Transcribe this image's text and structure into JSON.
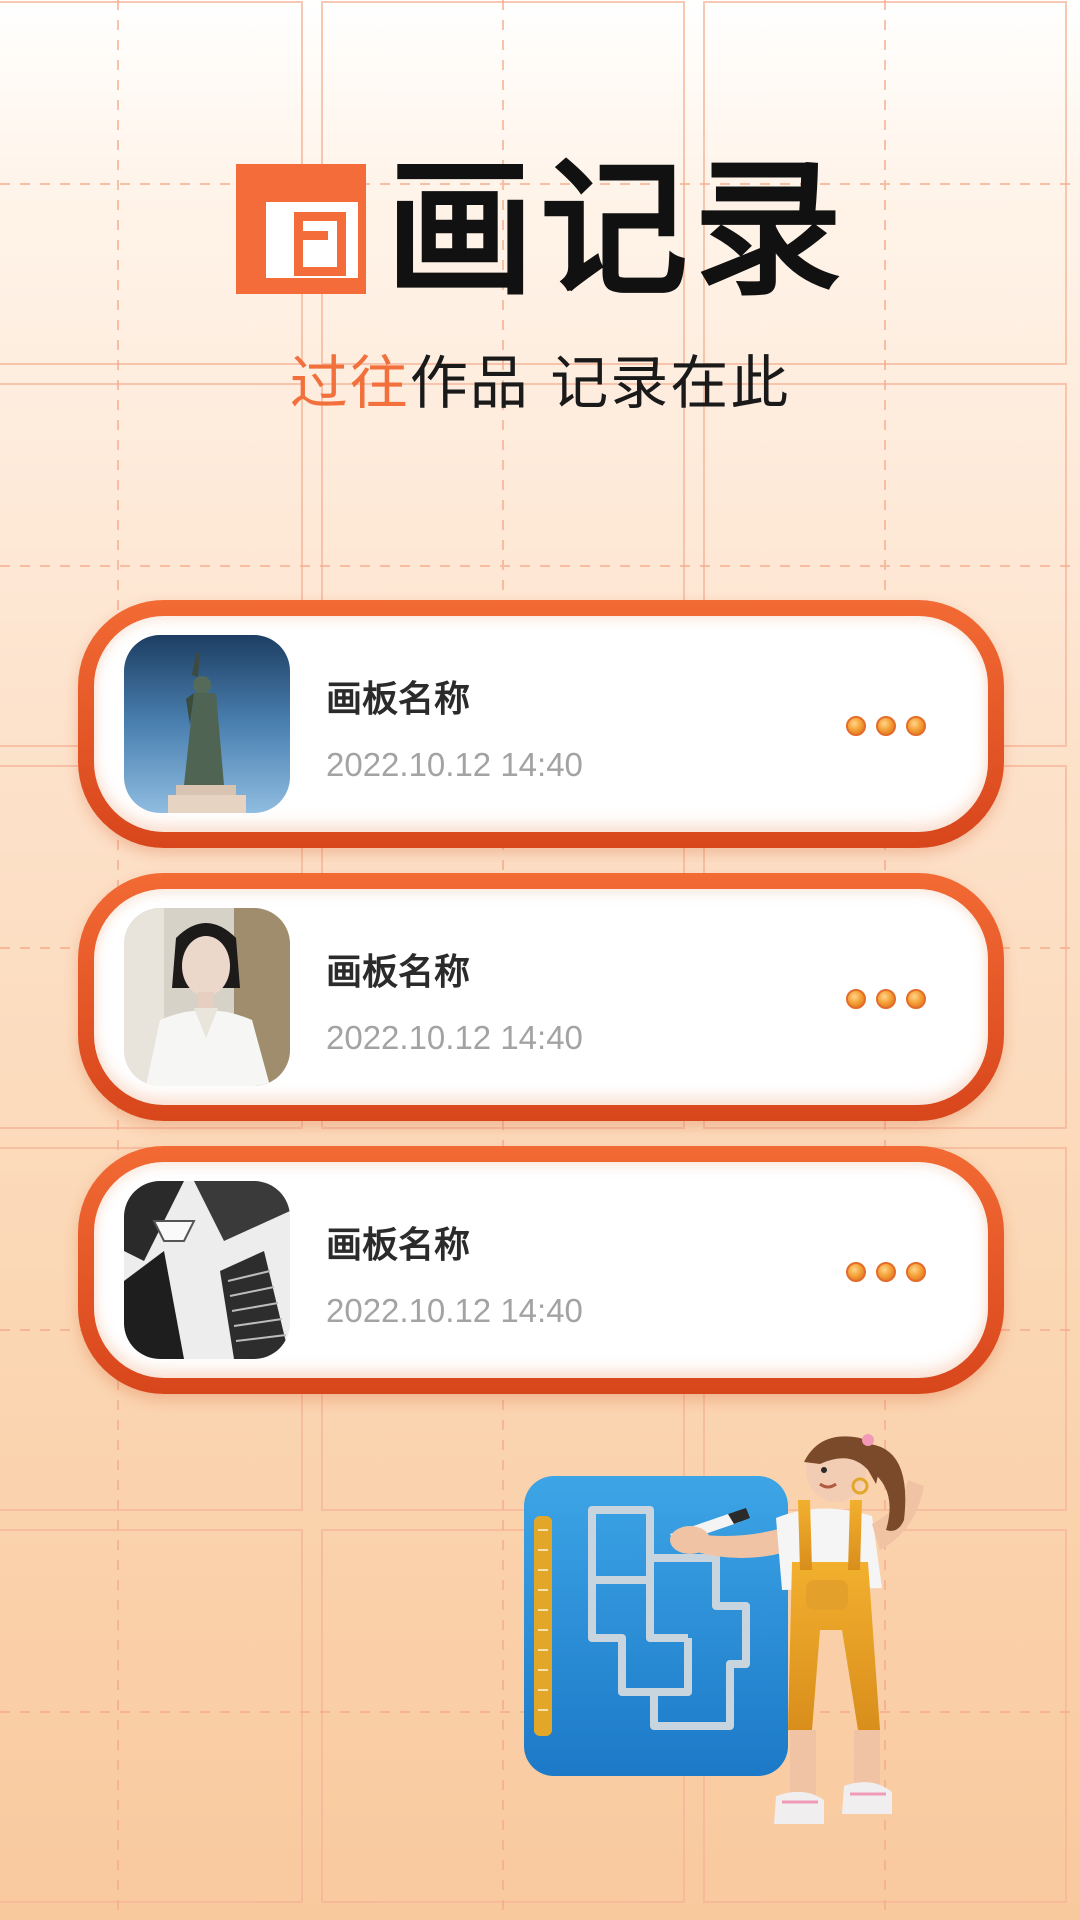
{
  "header": {
    "title": "画记录",
    "subtitle_accent": "过往",
    "subtitle_rest": "作品 记录在此"
  },
  "records": [
    {
      "name": "画板名称",
      "date": "2022.10.12 14:40",
      "thumbnail": "statue-of-liberty-photo"
    },
    {
      "name": "画板名称",
      "date": "2022.10.12 14:40",
      "thumbnail": "woman-portrait-photo"
    },
    {
      "name": "画板名称",
      "date": "2022.10.12 14:40",
      "thumbnail": "skyscrapers-photo"
    }
  ],
  "icons": {
    "logo": "square-logo-icon",
    "more": "more-dots-icon",
    "illustration": "girl-drawing-floorplan-illustration"
  },
  "colors": {
    "accent": "#f36c3a",
    "card_border": "#e0501f",
    "background_top": "#ffffff",
    "background_bottom": "#f9c99e",
    "date_text": "#a3a3a3"
  }
}
